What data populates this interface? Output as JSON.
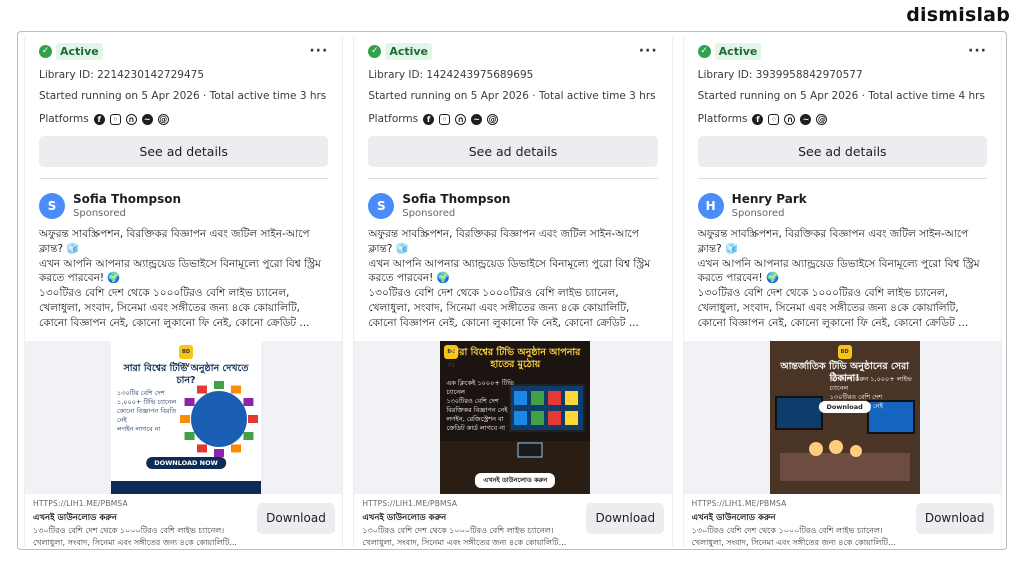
{
  "brand": "dismislab",
  "cards": [
    {
      "status": "Active",
      "library_id": "Library ID: 2214230142729475",
      "started": "Started running on 5 Apr 2026 · Total active time 3 hrs",
      "platforms_label": "Platforms",
      "details_button": "See ad details",
      "avatar_letter": "S",
      "advertiser": "Sofia Thompson",
      "sponsored": "Sponsored",
      "body": [
        "অফুরন্ত সাবস্ক্রিপশন, বিরক্তিকর বিজ্ঞাপন এবং জটিল সাইন-আপে ক্লান্ত? 🧊",
        "এখন আপনি আপনার অ্যান্ড্রয়েড ডিভাইসে বিনামূল্যে পুরো বিশ্ব স্ট্রিম করতে পারবেন! 🌍",
        "১৩০টিরও বেশি দেশ থেকে ১০০০টিরও বেশি লাইভ চ্যানেল, খেলাধুলা, সংবাদ, সিনেমা এবং সঙ্গীতের জন্য ৪কে কোয়ালিটি, কোনো বিজ্ঞাপন নেই, কোনো লুকানো ফি নেই, কোনো ক্রেডিট ..."
      ],
      "creative": {
        "title": "সারা বিশ্বের টিভি অনুষ্ঠান দেখতে চান?",
        "bullets": [
          "১৩০টির বেশি দেশ",
          "১,০০০+ টিভি চ্যানেল",
          "কোনো বিজ্ঞাপন বিরতি নেই",
          "লগইন লাগবে না"
        ],
        "button": "DOWNLOAD NOW",
        "logo": "BD TV",
        "bg": "#ffffff",
        "title_color": "#0d2b55",
        "accent": "#1a5fb4"
      },
      "url": "HTTPS://LIH1.ME/PBMSA",
      "cta_title": "এখনই ডাউনলোড করুন",
      "cta_desc": [
        "১৩০টিরও বেশি দেশ থেকে ১০০০টিরও বেশি লাইভ চ্যানেল।",
        "খেলাধুলা, সংবাদ, সিনেমা এবং সঙ্গীতের জন্য ৪কে কোয়ালিটি..."
      ],
      "download_button": "Download"
    },
    {
      "status": "Active",
      "library_id": "Library ID: 1424243975689695",
      "started": "Started running on 5 Apr 2026 · Total active time 3 hrs",
      "platforms_label": "Platforms",
      "details_button": "See ad details",
      "avatar_letter": "S",
      "advertiser": "Sofia Thompson",
      "sponsored": "Sponsored",
      "body": [
        "অফুরন্ত সাবস্ক্রিপশন, বিরক্তিকর বিজ্ঞাপন এবং জটিল সাইন-আপে ক্লান্ত? 🧊",
        "এখন আপনি আপনার অ্যান্ড্রয়েড ডিভাইসে বিনামূল্যে পুরো বিশ্ব স্ট্রিম করতে পারবেন! 🌍",
        "১৩০টিরও বেশি দেশ থেকে ১০০০টিরও বেশি লাইভ চ্যানেল, খেলাধুলা, সংবাদ, সিনেমা এবং সঙ্গীতের জন্য ৪কে কোয়ালিটি, কোনো বিজ্ঞাপন নেই, কোনো লুকানো ফি নেই, কোনো ক্রেডিট ..."
      ],
      "creative": {
        "title": "সারা বিশ্বের টিভি অনুষ্ঠান আপনার হাতের মুঠোয়",
        "bullets": [
          "এক ক্লিকেই ১০০০+ টিভি চ্যানেল",
          "১৩০টিরও বেশি দেশ",
          "বিরক্তিকর বিজ্ঞাপন নেই",
          "লগইন, রেজিস্ট্রেশন বা ক্রেডিট কার্ড লাগবে না"
        ],
        "button": "এখনই ডাউনলোড করুন",
        "logo": "BD TV",
        "bg": "#1b1410",
        "title_color": "#ffd23f",
        "accent": "#e8a317"
      },
      "url": "HTTPS://LIH1.ME/PBMSA",
      "cta_title": "এখনই ডাউনলোড করুন",
      "cta_desc": [
        "১৩০টিরও বেশি দেশ থেকে ১০০০টিরও বেশি লাইভ চ্যানেল।",
        "খেলাধুলা, সংবাদ, সিনেমা এবং সঙ্গীতের জন্য ৪কে কোয়ালিটি..."
      ],
      "download_button": "Download"
    },
    {
      "status": "Active",
      "library_id": "Library ID: 3939958842970577",
      "started": "Started running on 5 Apr 2026 · Total active time 4 hrs",
      "platforms_label": "Platforms",
      "details_button": "See ad details",
      "avatar_letter": "H",
      "advertiser": "Henry Park",
      "sponsored": "Sponsored",
      "body": [
        "অফুরন্ত সাবস্ক্রিপশন, বিরক্তিকর বিজ্ঞাপন এবং জটিল সাইন-আপে ক্লান্ত? 🧊",
        "এখন আপনি আপনার অ্যান্ড্রয়েড ডিভাইসে বিনামূল্যে পুরো বিশ্ব স্ট্রিম করতে পারবেন! 🌍",
        "১৩০টিরও বেশি দেশ থেকে ১০০০টিরও বেশি লাইভ চ্যানেল, খেলাধুলা, সংবাদ, সিনেমা এবং সঙ্গীতের জন্য ৪কে কোয়ালিটি, কোনো বিজ্ঞাপন নেই, কোনো লুকানো ফি নেই, কোনো ক্রেডিট ..."
      ],
      "creative": {
        "title": "আন্তর্জাতিক টিভি অনুষ্ঠানের সেরা ঠিকানা!",
        "bullets": [
          "উপভোগ করুন ১,০০০+ লাইভ চ্যানেল",
          "১৩০টিরও বেশি দেশ",
          "কোনো বিজ্ঞাপন নেই"
        ],
        "button": "Download",
        "logo": "BD TV",
        "bg": "#3b2a20",
        "title_color": "#ffffff",
        "accent": "#f5c518"
      },
      "url": "HTTPS://LIH1.ME/PBMSA",
      "cta_title": "এখনই ডাউনলোড করুন",
      "cta_desc": [
        "১৩০টিরও বেশি দেশ থেকে ১০০০টিরও বেশি লাইভ চ্যানেল।",
        "খেলাধুলা, সংবাদ, সিনেমা এবং সঙ্গীতের জন্য ৪কে কোয়ালিটি..."
      ],
      "download_button": "Download"
    }
  ]
}
